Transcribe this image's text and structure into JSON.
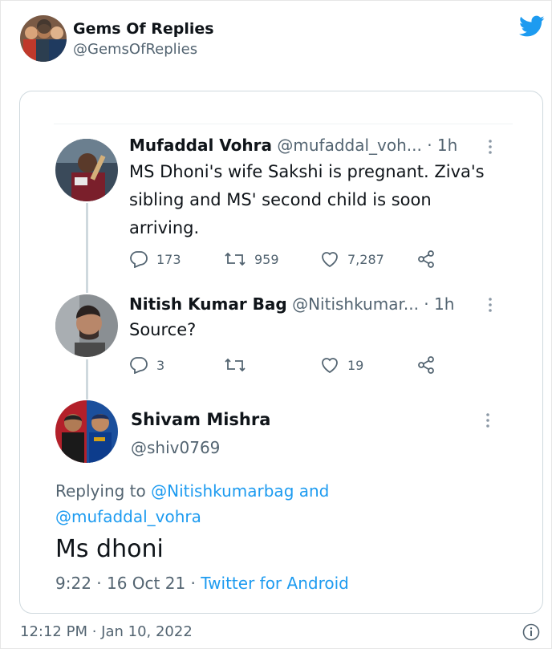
{
  "outer": {
    "name": "Gems Of Replies",
    "handle": "@GemsOfReplies",
    "timestamp": "12:12 PM · Jan 10, 2022",
    "brand_color": "#1d9bf0"
  },
  "thread": [
    {
      "name": "Mufaddal Vohra",
      "handle": "@mufaddal_voh...",
      "time": "· 1h",
      "text": "MS Dhoni's wife Sakshi is pregnant. Ziva's sibling and MS' second child is soon arriving.",
      "replies": "173",
      "retweets": "959",
      "likes": "7,287"
    },
    {
      "name": "Nitish Kumar Bag",
      "handle": "@Nitishkumar...",
      "time": "· 1h",
      "text": "Source?",
      "replies": "3",
      "retweets": "",
      "likes": "19"
    }
  ],
  "main_reply": {
    "name": "Shivam Mishra",
    "handle": "@shiv0769",
    "replying_prefix": "Replying to",
    "replying_to_1": "@Nitishkumarbag",
    "replying_and": "and",
    "replying_to_2": "@mufaddal_vohra",
    "text": "Ms dhoni",
    "time_date": "9:22 · 16 Oct 21 ·",
    "source": "Twitter for Android"
  },
  "icons": {
    "brand": "twitter-bird-icon",
    "reply": "reply-icon",
    "retweet": "retweet-icon",
    "like": "heart-icon",
    "share": "share-icon",
    "more": "more-options-icon",
    "info": "info-icon"
  }
}
